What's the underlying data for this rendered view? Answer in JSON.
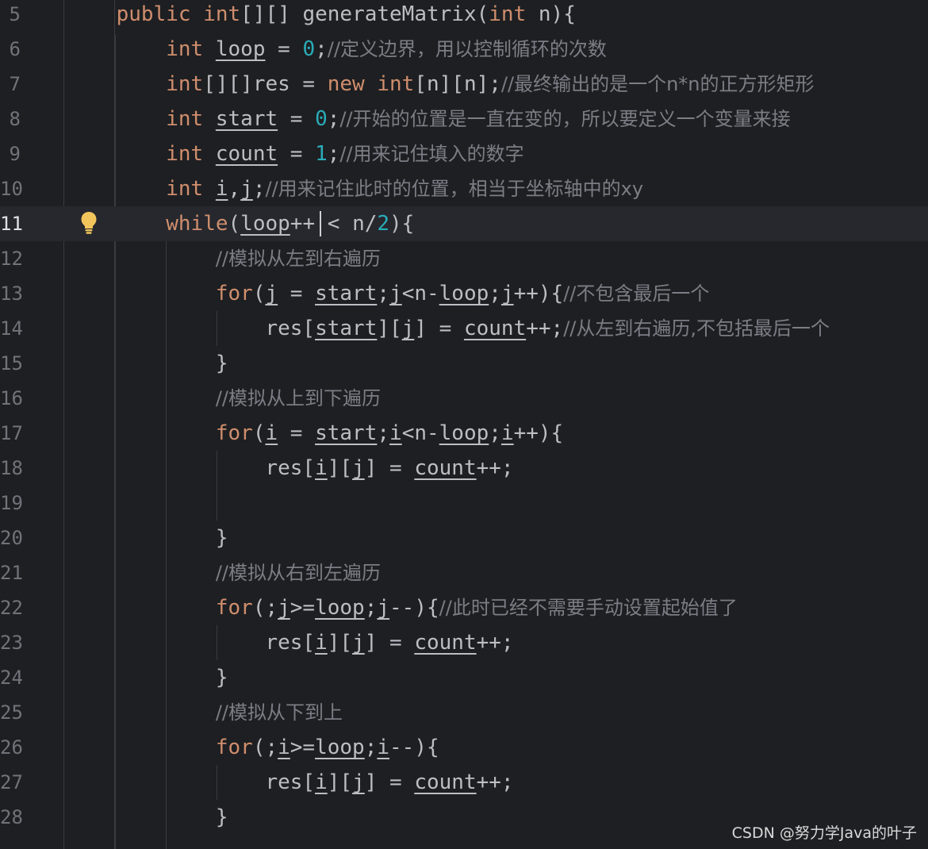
{
  "editor": {
    "theme_colors": {
      "background": "#1e1f22",
      "keyword": "#cf8e6d",
      "number": "#2aacb8",
      "comment": "#7a7e85",
      "text": "#bcbec4",
      "current_line": "#26282e"
    },
    "current_line_number": "11",
    "gutter_icon": "lightbulb-icon",
    "lines": [
      {
        "n": "5",
        "parts": [
          [
            "",
            "    "
          ],
          [
            "kw",
            "public "
          ],
          [
            "kw",
            "int"
          ],
          [
            "",
            "[][] "
          ],
          [
            "fnc",
            "generateMatrix"
          ],
          [
            "",
            "("
          ],
          [
            "kw",
            "int"
          ],
          [
            "",
            " n){"
          ]
        ]
      },
      {
        "n": "6",
        "parts": [
          [
            "",
            "        "
          ],
          [
            "kw",
            "int "
          ],
          [
            "var",
            "loop"
          ],
          [
            "",
            " = "
          ],
          [
            "num",
            "0"
          ],
          [
            "",
            ";"
          ],
          [
            "cm",
            "//定义边界，用以控制循环的次数"
          ]
        ]
      },
      {
        "n": "7",
        "parts": [
          [
            "",
            "        "
          ],
          [
            "kw",
            "int"
          ],
          [
            "",
            "[][]res = "
          ],
          [
            "kw",
            "new "
          ],
          [
            "kw",
            "int"
          ],
          [
            "",
            "[n][n];"
          ],
          [
            "cm",
            "//最终输出的是一个n*n的正方形矩形"
          ]
        ]
      },
      {
        "n": "8",
        "parts": [
          [
            "",
            "        "
          ],
          [
            "kw",
            "int "
          ],
          [
            "var",
            "start"
          ],
          [
            "",
            " = "
          ],
          [
            "num",
            "0"
          ],
          [
            "",
            ";"
          ],
          [
            "cm",
            "//开始的位置是一直在变的，所以要定义一个变量来接"
          ]
        ]
      },
      {
        "n": "9",
        "parts": [
          [
            "",
            "        "
          ],
          [
            "kw",
            "int "
          ],
          [
            "var",
            "count"
          ],
          [
            "",
            " = "
          ],
          [
            "num",
            "1"
          ],
          [
            "",
            ";"
          ],
          [
            "cm",
            "//用来记住填入的数字"
          ]
        ]
      },
      {
        "n": "10",
        "parts": [
          [
            "",
            "        "
          ],
          [
            "kw",
            "int "
          ],
          [
            "var",
            "i"
          ],
          [
            "",
            ","
          ],
          [
            "var",
            "j"
          ],
          [
            "",
            ";"
          ],
          [
            "cm",
            "//用来记住此时的位置，相当于坐标轴中的xy"
          ]
        ]
      },
      {
        "n": "11",
        "parts": [
          [
            "",
            "        "
          ],
          [
            "kw",
            "while"
          ],
          [
            "",
            "("
          ],
          [
            "var",
            "loop"
          ],
          [
            "",
            "++ < n/"
          ],
          [
            "num",
            "2"
          ],
          [
            "",
            "){"
          ]
        ]
      },
      {
        "n": "12",
        "parts": [
          [
            "",
            "            "
          ],
          [
            "cm",
            "//模拟从左到右遍历"
          ]
        ]
      },
      {
        "n": "13",
        "parts": [
          [
            "",
            "            "
          ],
          [
            "kw",
            "for"
          ],
          [
            "",
            "("
          ],
          [
            "var",
            "j"
          ],
          [
            "",
            " = "
          ],
          [
            "var",
            "start"
          ],
          [
            "",
            ";"
          ],
          [
            "var",
            "j"
          ],
          [
            "",
            "<n-"
          ],
          [
            "var",
            "loop"
          ],
          [
            "",
            ";"
          ],
          [
            "var",
            "j"
          ],
          [
            "",
            "++){"
          ],
          [
            "cm",
            "//不包含最后一个"
          ]
        ]
      },
      {
        "n": "14",
        "parts": [
          [
            "",
            "                "
          ],
          [
            "",
            "res["
          ],
          [
            "var",
            "start"
          ],
          [
            "",
            "]["
          ],
          [
            "var",
            "j"
          ],
          [
            "",
            "] = "
          ],
          [
            "var",
            "count"
          ],
          [
            "",
            "++;"
          ],
          [
            "cm",
            "//从左到右遍历,不包括最后一个"
          ]
        ]
      },
      {
        "n": "15",
        "parts": [
          [
            "",
            "            "
          ],
          [
            "",
            "}"
          ]
        ]
      },
      {
        "n": "16",
        "parts": [
          [
            "",
            "            "
          ],
          [
            "cm",
            "//模拟从上到下遍历"
          ]
        ]
      },
      {
        "n": "17",
        "parts": [
          [
            "",
            "            "
          ],
          [
            "kw",
            "for"
          ],
          [
            "",
            "("
          ],
          [
            "var",
            "i"
          ],
          [
            "",
            " = "
          ],
          [
            "var",
            "start"
          ],
          [
            "",
            ";"
          ],
          [
            "var",
            "i"
          ],
          [
            "",
            "<n-"
          ],
          [
            "var",
            "loop"
          ],
          [
            "",
            ";"
          ],
          [
            "var",
            "i"
          ],
          [
            "",
            "++){"
          ]
        ]
      },
      {
        "n": "18",
        "parts": [
          [
            "",
            "                "
          ],
          [
            "",
            "res["
          ],
          [
            "var",
            "i"
          ],
          [
            "",
            "]["
          ],
          [
            "var",
            "j"
          ],
          [
            "",
            "] = "
          ],
          [
            "var",
            "count"
          ],
          [
            "",
            "++;"
          ]
        ]
      },
      {
        "n": "19",
        "parts": []
      },
      {
        "n": "20",
        "parts": [
          [
            "",
            "            "
          ],
          [
            "",
            "}"
          ]
        ]
      },
      {
        "n": "21",
        "parts": [
          [
            "",
            "            "
          ],
          [
            "cm",
            "//模拟从右到左遍历"
          ]
        ]
      },
      {
        "n": "22",
        "parts": [
          [
            "",
            "            "
          ],
          [
            "kw",
            "for"
          ],
          [
            "",
            "(;"
          ],
          [
            "var",
            "j"
          ],
          [
            "",
            ">="
          ],
          [
            "var",
            "loop"
          ],
          [
            "",
            ";"
          ],
          [
            "var",
            "j"
          ],
          [
            "",
            "--){"
          ],
          [
            "cm",
            "//此时已经不需要手动设置起始值了"
          ]
        ]
      },
      {
        "n": "23",
        "parts": [
          [
            "",
            "                "
          ],
          [
            "",
            "res["
          ],
          [
            "var",
            "i"
          ],
          [
            "",
            "]["
          ],
          [
            "var",
            "j"
          ],
          [
            "",
            "] = "
          ],
          [
            "var",
            "count"
          ],
          [
            "",
            "++;"
          ]
        ]
      },
      {
        "n": "24",
        "parts": [
          [
            "",
            "            "
          ],
          [
            "",
            "}"
          ]
        ]
      },
      {
        "n": "25",
        "parts": [
          [
            "",
            "            "
          ],
          [
            "cm",
            "//模拟从下到上"
          ]
        ]
      },
      {
        "n": "26",
        "parts": [
          [
            "",
            "            "
          ],
          [
            "kw",
            "for"
          ],
          [
            "",
            "(;"
          ],
          [
            "var",
            "i"
          ],
          [
            "",
            ">="
          ],
          [
            "var",
            "loop"
          ],
          [
            "",
            ";"
          ],
          [
            "var",
            "i"
          ],
          [
            "",
            "--){"
          ]
        ]
      },
      {
        "n": "27",
        "parts": [
          [
            "",
            "                "
          ],
          [
            "",
            "res["
          ],
          [
            "var",
            "i"
          ],
          [
            "",
            "]["
          ],
          [
            "var",
            "j"
          ],
          [
            "",
            "] = "
          ],
          [
            "var",
            "count"
          ],
          [
            "",
            "++;"
          ]
        ]
      },
      {
        "n": "28",
        "parts": [
          [
            "",
            "            "
          ],
          [
            "",
            "}"
          ]
        ]
      }
    ]
  },
  "watermark": "CSDN @努力学Java的叶子"
}
